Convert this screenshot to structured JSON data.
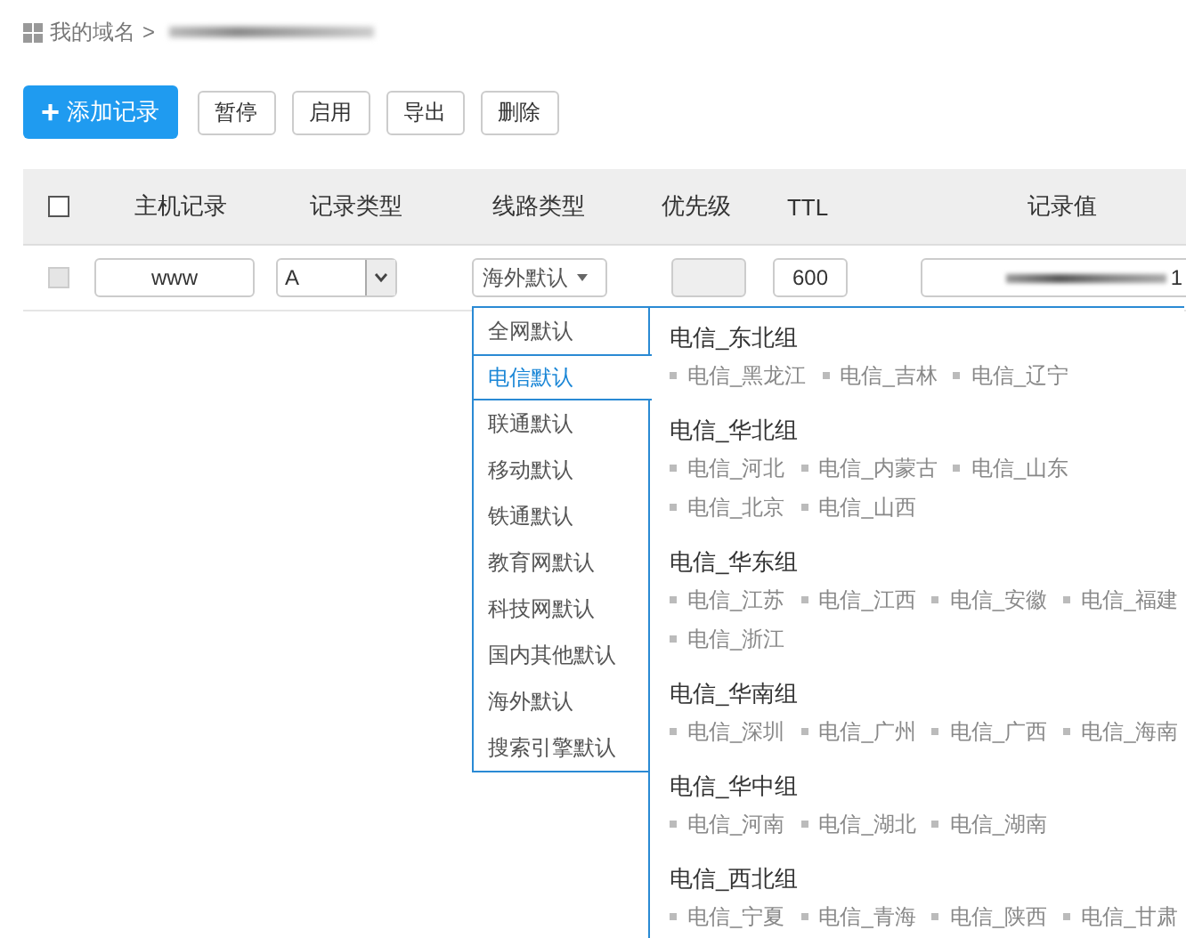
{
  "breadcrumb": {
    "root": "我的域名",
    "separator": ">"
  },
  "toolbar": {
    "buttons": [
      {
        "label": "添加记录",
        "kind": "primary",
        "icon": "+"
      },
      {
        "label": "暂停",
        "kind": "default"
      },
      {
        "label": "启用",
        "kind": "default"
      },
      {
        "label": "导出",
        "kind": "default"
      },
      {
        "label": "删除",
        "kind": "default"
      }
    ]
  },
  "table": {
    "header_checkbox": {
      "checked": false
    },
    "columns": [
      "主机记录",
      "记录类型",
      "线路类型",
      "优先级",
      "TTL",
      "记录值"
    ],
    "rows": [
      {
        "checked": false,
        "disabled": true,
        "host": "www",
        "type": "A",
        "line": "海外默认",
        "priority_disabled": true,
        "ttl": "600",
        "value": "1"
      }
    ]
  },
  "line_menu": {
    "options": [
      {
        "label": "全网默认",
        "selected": false
      },
      {
        "label": "电信默认",
        "selected": true
      },
      {
        "label": "联通默认",
        "selected": false
      },
      {
        "label": "移动默认",
        "selected": false
      },
      {
        "label": "铁通默认",
        "selected": false
      },
      {
        "label": "教育网默认",
        "selected": false
      },
      {
        "label": "科技网默认",
        "selected": false
      },
      {
        "label": "国内其他默认",
        "selected": false
      },
      {
        "label": "海外默认",
        "selected": false
      },
      {
        "label": "搜索引擎默认",
        "selected": false
      }
    ],
    "groups": [
      {
        "name": "电信_东北组",
        "items": [
          "电信_黑龙江",
          "电信_吉林",
          "电信_辽宁"
        ]
      },
      {
        "name": "电信_华北组",
        "items": [
          "电信_河北",
          "电信_内蒙古",
          "电信_山东",
          "电信_北京",
          "电信_山西"
        ]
      },
      {
        "name": "电信_华东组",
        "items": [
          "电信_江苏",
          "电信_江西",
          "电信_安徽",
          "电信_福建",
          "电信_浙江"
        ]
      },
      {
        "name": "电信_华南组",
        "items": [
          "电信_深圳",
          "电信_广州",
          "电信_广西",
          "电信_海南"
        ]
      },
      {
        "name": "电信_华中组",
        "items": [
          "电信_河南",
          "电信_湖北",
          "电信_湖南"
        ]
      },
      {
        "name": "电信_西北组",
        "items": [
          "电信_宁夏",
          "电信_青海",
          "电信_陕西",
          "电信_甘肃"
        ]
      }
    ]
  }
}
